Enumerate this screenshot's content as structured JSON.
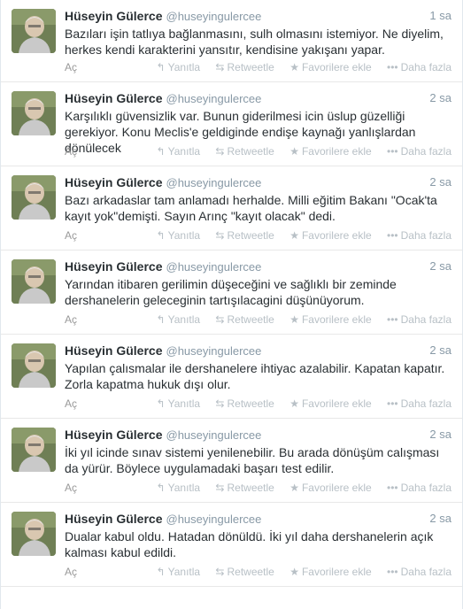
{
  "tweets": [
    {
      "fullname": "Hüseyin Gülerce",
      "username": "@huseyingulercee",
      "time": "1 sa",
      "text": "Bazıları işin tatlıya bağlanmasını, sulh olmasını istemiyor. Ne diyelim, herkes kendi karakterini yansıtır, kendisine yakışanı yapar.",
      "expand": "Aç"
    },
    {
      "fullname": "Hüseyin Gülerce",
      "username": "@huseyingulercee",
      "time": "2 sa",
      "text": "Karşılıklı güvensizlik var. Bunun giderilmesi icin üslup güzelliği gerekiyor. Konu Meclis'e geldiginde endişe kaynağı yanlışlardan dönülecek",
      "expand": "Aç"
    },
    {
      "fullname": "Hüseyin Gülerce",
      "username": "@huseyingulercee",
      "time": "2 sa",
      "text": "Bazı arkadaslar tam anlamadı herhalde. Milli eğitim Bakanı \"Ocak'ta kayıt yok\"demişti. Sayın Arınç \"kayıt olacak\" dedi.",
      "expand": "Aç"
    },
    {
      "fullname": "Hüseyin Gülerce",
      "username": "@huseyingulercee",
      "time": "2 sa",
      "text": "Yarından itibaren gerilimin düşeceğini ve sağlıklı bir zeminde dershanelerin geleceginin tartışılacagini düşünüyorum.",
      "expand": "Aç"
    },
    {
      "fullname": "Hüseyin Gülerce",
      "username": "@huseyingulercee",
      "time": "2 sa",
      "text": "Yapılan çalısmalar ile dershanelere ihtiyac azalabilir. Kapatan kapatır. Zorla kapatma hukuk dışı olur.",
      "expand": "Aç"
    },
    {
      "fullname": "Hüseyin Gülerce",
      "username": "@huseyingulercee",
      "time": "2 sa",
      "text": "İki yıl icinde sınav sistemi yenilenebilir. Bu arada dönüşüm calışması da yürür. Böylece uygulamadaki başarı test edilir.",
      "expand": "Aç"
    },
    {
      "fullname": "Hüseyin Gülerce",
      "username": "@huseyingulercee",
      "time": "2 sa",
      "text": "Dualar kabul oldu. Hatadan dönüldü. İki yıl daha dershanelerin açık kalması kabul edildi.",
      "expand": "Aç"
    }
  ],
  "actions": {
    "reply": "Yanıtla",
    "retweet": "Retweetle",
    "favorite": "Favorilere ekle",
    "more": "Daha fazla"
  },
  "icons": {
    "reply": "reply-arrow-icon",
    "retweet": "retweet-icon",
    "favorite": "star-icon",
    "more": "ellipsis-icon"
  },
  "colors": {
    "name": "#292f33",
    "muted": "#8899a6",
    "action": "#b8c0c6"
  }
}
